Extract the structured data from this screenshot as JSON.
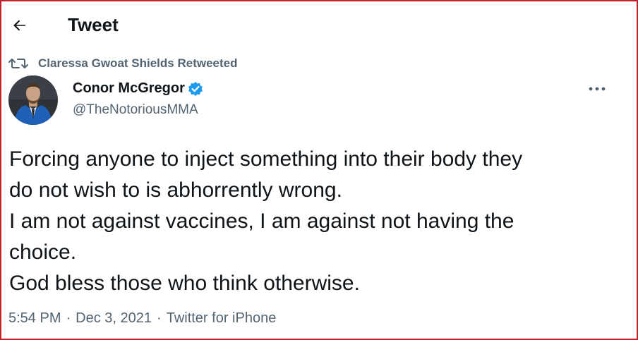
{
  "header": {
    "title": "Tweet",
    "back_icon": "arrow-left-icon"
  },
  "social_context": {
    "icon": "retweet-icon",
    "text": "Claressa Gwoat Shields Retweeted"
  },
  "author": {
    "name": "Conor McGregor",
    "handle": "@TheNotoriousMMA",
    "verified": true,
    "verified_color": "#1d9bf0"
  },
  "tweet": {
    "lines": [
      "Forcing anyone to inject something into their body they",
      "do not wish to is abhorrently wrong.",
      "I am not against vaccines, I am against not having the",
      "choice.",
      "God bless those who think otherwise."
    ]
  },
  "meta": {
    "time": "5:54 PM",
    "separator": "·",
    "date": "Dec 3, 2021",
    "source": "Twitter for iPhone"
  },
  "colors": {
    "text_primary": "#0f1419",
    "text_secondary": "#536471",
    "frame_border": "#c8202a"
  }
}
